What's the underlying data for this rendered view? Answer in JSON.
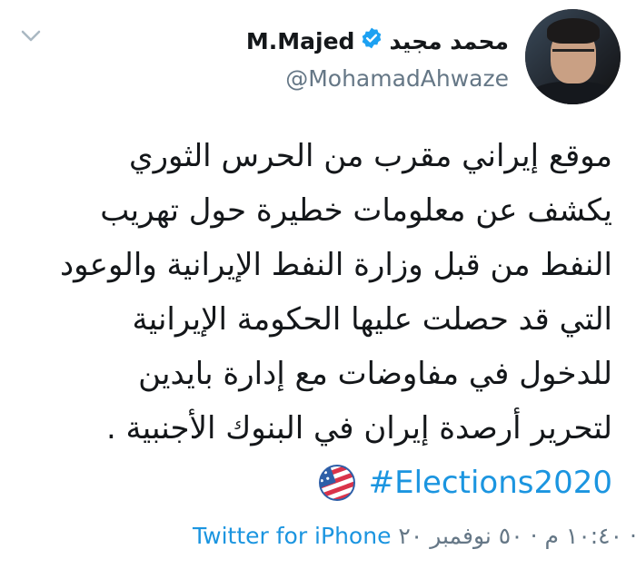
{
  "author": {
    "name_arabic": "محمد مجيد",
    "name_latin": "M.Majed",
    "handle": "@MohamadAhwaze",
    "verified": true
  },
  "tweet": {
    "lines": [
      "موقع إيراني مقرب من الحرس الثوري",
      "يكشف عن معلومات خطيرة حول تهريب",
      "النفط من قبل وزارة النفط الإيرانية والوعود",
      "التي قد حصلت عليها الحكومة الإيرانية",
      "للدخول في مفاوضات مع إدارة بايدين",
      "لتحرير أرصدة إيران في البنوك الأجنبية ."
    ],
    "hashtag": "#Elections2020"
  },
  "footer": {
    "timestamp": "١٠:٤٠ م · ٥٠ نوفمبر ٢٠ · ",
    "source": "Twitter for iPhone"
  },
  "colors": {
    "link": "#1b95e0",
    "muted": "#657786",
    "text": "#14171a"
  },
  "icons": {
    "menu": "chevron-down-icon",
    "verified": "verified-badge-icon",
    "hashtag_emoji": "us-flag-ballot-icon"
  }
}
